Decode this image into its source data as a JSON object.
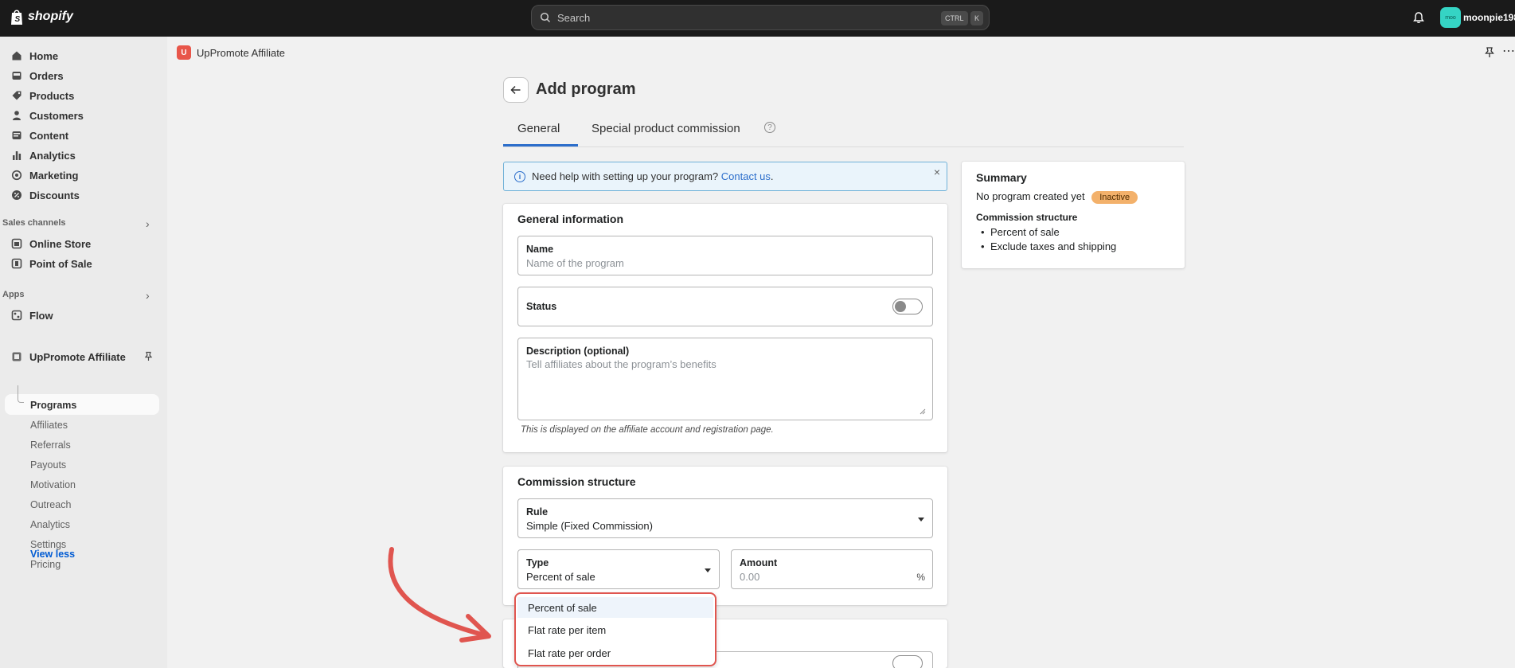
{
  "topbar": {
    "brand": "shopify",
    "search_placeholder": "Search",
    "shortcut_key1": "CTRL",
    "shortcut_key2": "K",
    "store_avatar": "moo",
    "store_name": "moonpie198"
  },
  "sidebar": {
    "items": [
      {
        "label": "Home",
        "icon": "home-icon"
      },
      {
        "label": "Orders",
        "icon": "inbox-icon"
      },
      {
        "label": "Products",
        "icon": "tag-icon"
      },
      {
        "label": "Customers",
        "icon": "person-icon"
      },
      {
        "label": "Content",
        "icon": "content-icon"
      },
      {
        "label": "Analytics",
        "icon": "bar-chart-icon"
      },
      {
        "label": "Marketing",
        "icon": "target-icon"
      },
      {
        "label": "Discounts",
        "icon": "discount-icon"
      }
    ],
    "sales_channels_label": "Sales channels",
    "sales_channels": [
      {
        "label": "Online Store",
        "icon": "store-icon"
      },
      {
        "label": "Point of Sale",
        "icon": "pos-icon"
      }
    ],
    "apps_label": "Apps",
    "apps": [
      {
        "label": "Flow",
        "icon": "flow-icon"
      },
      {
        "label": "UpPromote Affiliate",
        "icon": "app-icon"
      }
    ],
    "sub_items": [
      "Programs",
      "Affiliates",
      "Referrals",
      "Payouts",
      "Motivation",
      "Outreach",
      "Analytics",
      "Settings",
      "Pricing"
    ],
    "view_less": "View less"
  },
  "app_header": {
    "icon_letter": "U",
    "title": "UpPromote Affiliate"
  },
  "page": {
    "title": "Add program",
    "tabs": [
      "General",
      "Special product commission"
    ],
    "help_glyph": "?"
  },
  "banner": {
    "text": "Need help with setting up your program?",
    "link": "Contact us",
    "suffix": ".",
    "close": "×"
  },
  "general_info": {
    "title": "General information",
    "name_label": "Name",
    "name_placeholder": "Name of the program",
    "status_label": "Status",
    "description_label": "Description (optional)",
    "description_placeholder": "Tell affiliates about the program’s benefits",
    "helper_text": "This is displayed on the affiliate account and registration page."
  },
  "commission": {
    "title": "Commission structure",
    "rule_label": "Rule",
    "rule_value": "Simple (Fixed Commission)",
    "type_label": "Type",
    "type_value": "Percent of sale",
    "amount_label": "Amount",
    "amount_placeholder": "0.00",
    "amount_suffix": "%"
  },
  "type_dropdown": {
    "options": [
      "Percent of sale",
      "Flat rate per item",
      "Flat rate per order"
    ],
    "highlighted_index": 0
  },
  "summary": {
    "title": "Summary",
    "status_text": "No program created yet",
    "badge": "Inactive",
    "structure_label": "Commission structure",
    "bullets": [
      "Percent of sale",
      "Exclude taxes and shipping"
    ]
  },
  "colors": {
    "accent": "#2c6ecb",
    "annotation_red": "#e0554f",
    "badge": "#f3b16b"
  }
}
